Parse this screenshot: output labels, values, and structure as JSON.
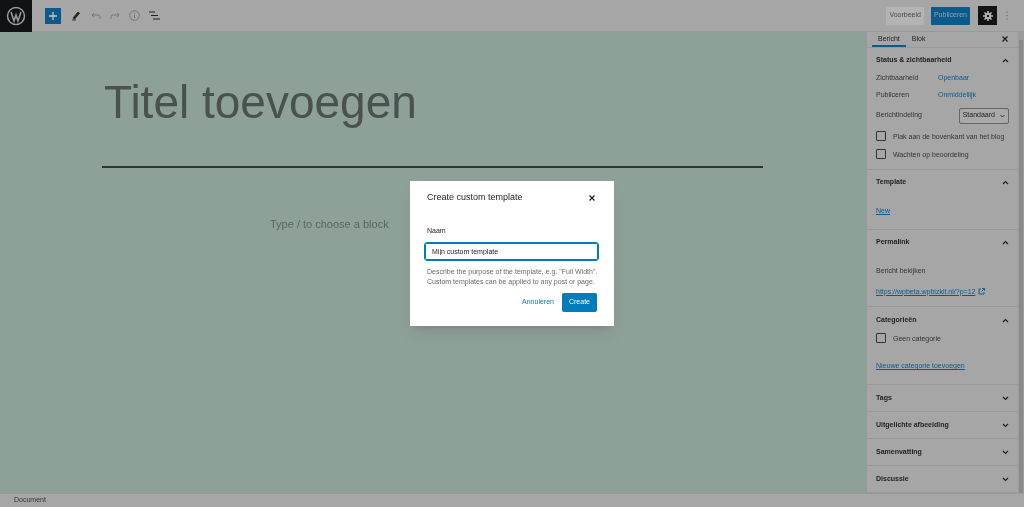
{
  "toolbar": {
    "preview_button": "Voorbeeld",
    "publish_button": "Publiceren"
  },
  "editor": {
    "title_placeholder": "Titel toevoegen",
    "block_placeholder": "Type / to choose a block"
  },
  "sidebar": {
    "tabs": [
      {
        "label": "Bericht",
        "selected": true
      },
      {
        "label": "Blok",
        "selected": false
      }
    ],
    "panels": [
      {
        "title": "Status & zichtbaarheid",
        "expanded": true,
        "rows": [
          {
            "kind": "link",
            "label": "Zichtbaarheid",
            "value": "Openbaar"
          },
          {
            "kind": "link",
            "label": "Publiceren",
            "value": "Onmiddellijk"
          },
          {
            "kind": "select",
            "label": "Berichtindeling",
            "value": "Standaard"
          },
          {
            "kind": "checkbox",
            "label": "Plak aan de bovenkant van het blog",
            "checked": false
          },
          {
            "kind": "checkbox",
            "label": "Wachten op beoordeling",
            "checked": false
          }
        ]
      },
      {
        "title": "Template",
        "expanded": true,
        "rows": [
          {
            "kind": "plain_link",
            "value": "New"
          }
        ]
      },
      {
        "title": "Permalink",
        "expanded": true,
        "rows": [
          {
            "kind": "text",
            "label": "Bericht bekijken"
          },
          {
            "kind": "external_link",
            "value": "https://wpbeta.wpbizkit.nl/?p=12"
          }
        ]
      },
      {
        "title": "Categorieën",
        "expanded": true,
        "rows": [
          {
            "kind": "checkbox",
            "label": "Geen categorie",
            "checked": false
          },
          {
            "kind": "plain_link",
            "value": "Nieuwe categorie toevoegen"
          }
        ]
      },
      {
        "title": "Tags",
        "expanded": false
      },
      {
        "title": "Uitgelichte afbeelding",
        "expanded": false
      },
      {
        "title": "Samenvatting",
        "expanded": false
      },
      {
        "title": "Discussie",
        "expanded": false
      }
    ]
  },
  "modal": {
    "title": "Create custom template",
    "field_label": "Naam",
    "field_value": "Mijn custom template",
    "help": "Describe the purpose of the template, e.g. \"Full Width\". Custom templates can be applied to any post or page.",
    "cancel_button": "Annuleren",
    "create_button": "Create"
  },
  "status_bar": {
    "label": "Document"
  }
}
